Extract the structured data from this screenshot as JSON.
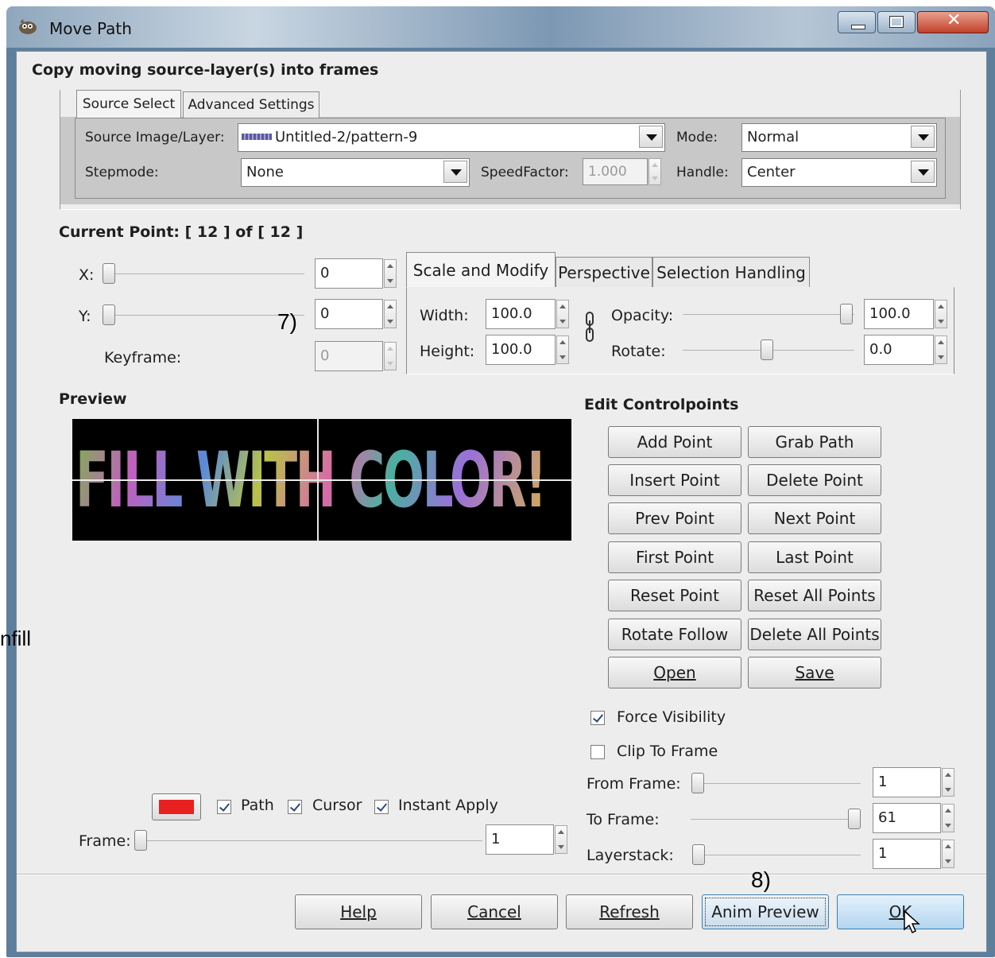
{
  "window": {
    "title": "Move Path"
  },
  "dialog": {
    "heading": "Copy moving source-layer(s) into frames"
  },
  "source_tabs": [
    "Source Select",
    "Advanced Settings"
  ],
  "source": {
    "image_layer_label": "Source Image/Layer:",
    "image_layer_value": "Untitled-2/pattern-9",
    "mode_label": "Mode:",
    "mode_value": "Normal",
    "stepmode_label": "Stepmode:",
    "stepmode_value": "None",
    "speedfactor_label": "SpeedFactor:",
    "speedfactor_value": "1.000",
    "handle_label": "Handle:",
    "handle_value": "Center"
  },
  "current_point": {
    "text": "Current Point: [ 12 ] of [ 12 ]"
  },
  "point": {
    "x_label": "X:",
    "x_value": "0",
    "y_label": "Y:",
    "y_value": "0",
    "keyframe_label": "Keyframe:",
    "keyframe_value": "0"
  },
  "modify_tabs": [
    "Scale and Modify",
    "Perspective",
    "Selection Handling"
  ],
  "scale": {
    "width_label": "Width:",
    "width_value": "100.0",
    "height_label": "Height:",
    "height_value": "100.0",
    "opacity_label": "Opacity:",
    "opacity_value": "100.0",
    "rotate_label": "Rotate:",
    "rotate_value": "0.0",
    "opacity_level": 1.0,
    "rotate_level": 0.5
  },
  "annotations": {
    "step7": "7)",
    "step8": "8)",
    "edge_text": "nfill"
  },
  "preview": {
    "label": "Preview",
    "image_text": "FILL WITH COLOR!"
  },
  "edit_controlpoints": {
    "title": "Edit Controlpoints",
    "add_point": "Add Point",
    "grab_path": "Grab Path",
    "insert_point": "Insert Point",
    "delete_point": "Delete Point",
    "prev_point": "Prev Point",
    "next_point": "Next Point",
    "first_point": "First Point",
    "last_point": "Last Point",
    "reset_point": "Reset Point",
    "reset_all_points": "Reset All Points",
    "rotate_follow": "Rotate Follow",
    "delete_all_points": "Delete All Points",
    "open": "Open",
    "save": "Save"
  },
  "options": {
    "force_visibility": "Force Visibility",
    "force_visibility_checked": true,
    "clip_to_frame": "Clip To Frame",
    "clip_to_frame_checked": false,
    "from_frame_label": "From Frame:",
    "from_frame_value": "1",
    "to_frame_label": "To Frame:",
    "to_frame_value": "61",
    "layerstack_label": "Layerstack:",
    "layerstack_value": "1"
  },
  "preview_controls": {
    "path_color": "#e82020",
    "path_label": "Path",
    "cursor_label": "Cursor",
    "instant_apply_label": "Instant Apply",
    "frame_label": "Frame:",
    "frame_value": "1"
  },
  "buttons": {
    "help": "Help",
    "cancel": "Cancel",
    "refresh": "Refresh",
    "anim_preview": "Anim Preview",
    "ok": "OK"
  }
}
